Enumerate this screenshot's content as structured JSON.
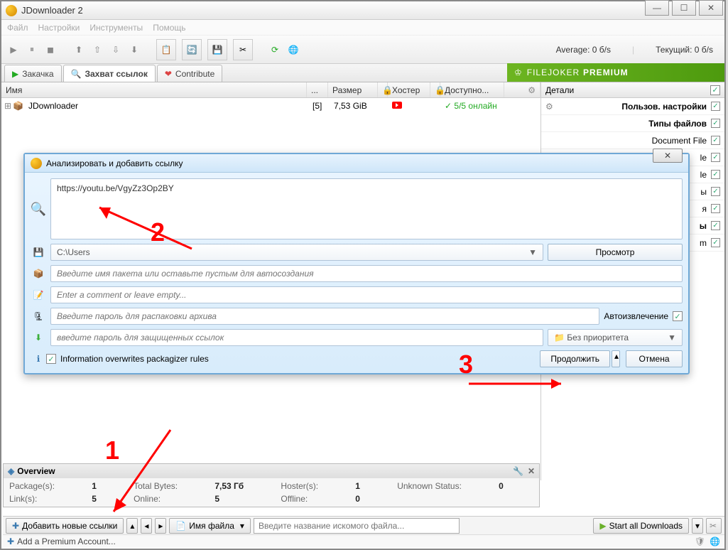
{
  "app": {
    "title": "JDownloader 2"
  },
  "menu": {
    "file": "Файл",
    "settings": "Настройки",
    "tools": "Инструменты",
    "help": "Помощь"
  },
  "toolbar_status": {
    "average": "Average: 0 б/s",
    "current": "Текущий: 0 б/s"
  },
  "tabs": {
    "download": "Закачка",
    "linkgrabber": "Захват ссылок",
    "contribute": "Contribute"
  },
  "filejoker": {
    "brand": "FILEJOKER",
    "premium": "PREMIUM"
  },
  "table": {
    "headers": {
      "name": "Имя",
      "dots": "...",
      "size": "Размер",
      "hoster": "Хостер",
      "available": "Доступно..."
    },
    "row": {
      "name": "JDownloader",
      "count": "[5]",
      "size": "7,53 GiB",
      "available": "5/5 онлайн"
    }
  },
  "right": {
    "details": "Детали",
    "user_settings": "Пользов. настройки",
    "file_types": "Типы файлов",
    "items": [
      "Document File",
      "le",
      "le",
      "ы",
      "я",
      "ы",
      "m"
    ]
  },
  "dialog": {
    "title": "Анализировать и добавить ссылку",
    "url": "https://youtu.be/VgyZz3Op2BY",
    "path": "C:\\Users",
    "browse": "Просмотр",
    "package_placeholder": "Введите имя пакета или оставьте пустым для автосоздания",
    "comment_placeholder": "Enter a comment or leave empty...",
    "archive_pw_placeholder": "Введите пароль для распаковки архива",
    "autoextract": "Автоизвлечение",
    "link_pw_placeholder": "введите пароль для защищенных ссылок",
    "priority": "Без приоритета",
    "overwrite_label": "Information overwrites packagizer rules",
    "continue": "Продолжить",
    "cancel": "Отмена"
  },
  "overview": {
    "title": "Overview",
    "packages": "Package(s):",
    "packages_v": "1",
    "total_bytes": "Total Bytes:",
    "total_bytes_v": "7,53 Гб",
    "hosters": "Hoster(s):",
    "hosters_v": "1",
    "unknown": "Unknown Status:",
    "unknown_v": "0",
    "links": "Link(s):",
    "links_v": "5",
    "online": "Online:",
    "online_v": "5",
    "offline": "Offline:",
    "offline_v": "0"
  },
  "bottom": {
    "add_links": "Добавить новые ссылки",
    "filename": "Имя файла",
    "search_placeholder": "Введите название искомого файла...",
    "start_all": "Start all Downloads"
  },
  "premium_bar": {
    "add_account": "Add a Premium Account..."
  },
  "annotations": {
    "one": "1",
    "two": "2",
    "three": "3"
  }
}
